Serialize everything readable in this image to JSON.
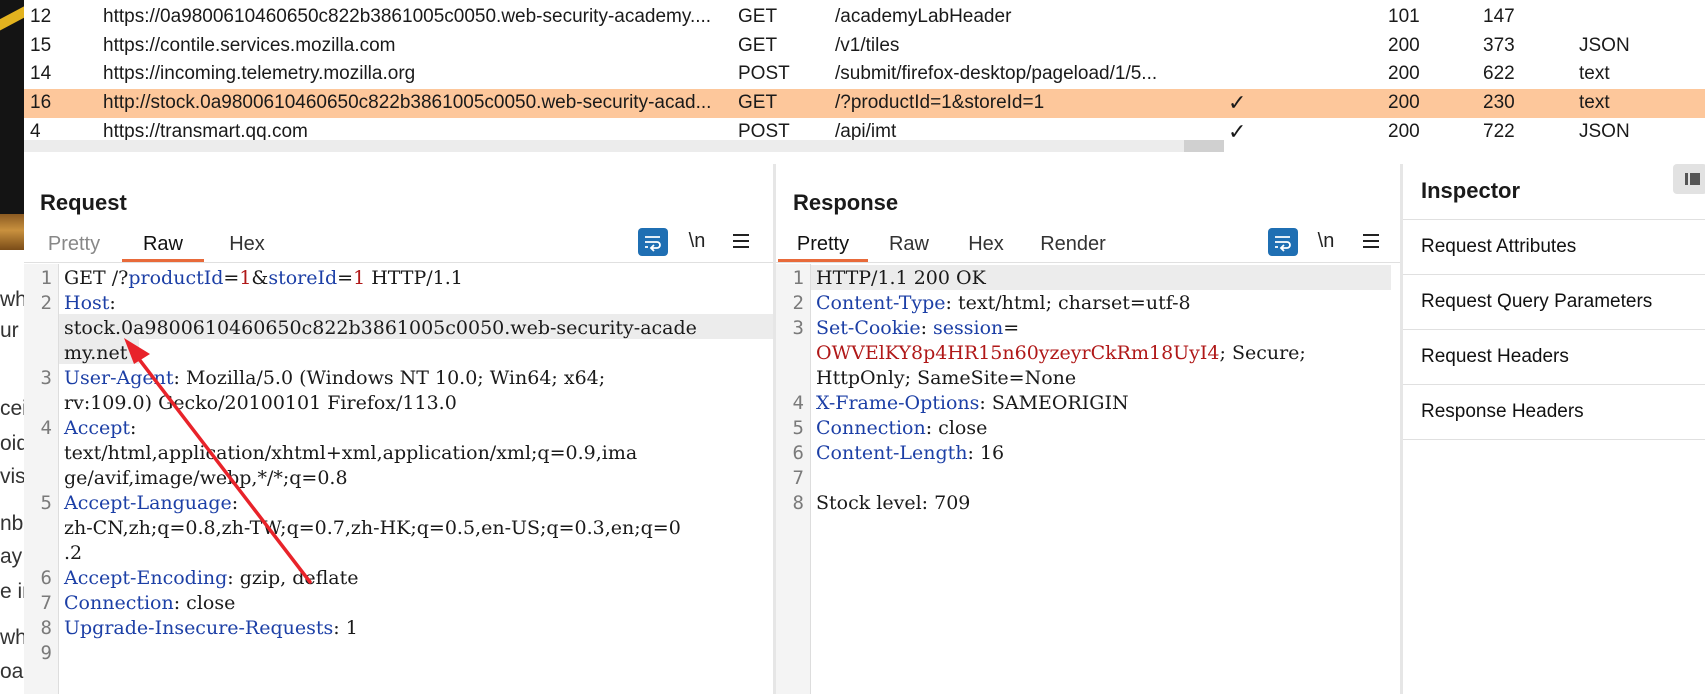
{
  "left_strip": {
    "fragments": [
      "wh",
      "ur",
      "cei",
      "oid",
      "vish",
      "nbo",
      "ay",
      "e in",
      "whe",
      "oac"
    ]
  },
  "history": {
    "rows": [
      {
        "id": "12",
        "host": "https://0a9800610460650c822b3861005c0050.web-security-academy....",
        "method": "GET",
        "url": "/academyLabHeader",
        "checked": "",
        "status": "101",
        "length": "147",
        "mime": ""
      },
      {
        "id": "15",
        "host": "https://contile.services.mozilla.com",
        "method": "GET",
        "url": "/v1/tiles",
        "checked": "",
        "status": "200",
        "length": "373",
        "mime": "JSON"
      },
      {
        "id": "14",
        "host": "https://incoming.telemetry.mozilla.org",
        "method": "POST",
        "url": "/submit/firefox-desktop/pageload/1/5...",
        "checked": "",
        "status": "200",
        "length": "622",
        "mime": "text"
      },
      {
        "id": "16",
        "host": "http://stock.0a9800610460650c822b3861005c0050.web-security-acad...",
        "method": "GET",
        "url": "/?productId=1&storeId=1",
        "checked": "✓",
        "status": "200",
        "length": "230",
        "mime": "text"
      },
      {
        "id": "4",
        "host": "https://transmart.qq.com",
        "method": "POST",
        "url": "/api/imt",
        "checked": "✓",
        "status": "200",
        "length": "722",
        "mime": "JSON"
      }
    ],
    "selected_index": 3
  },
  "request": {
    "title": "Request",
    "tabs": [
      "Pretty",
      "Raw",
      "Hex"
    ],
    "active_tab": "Raw",
    "newline_label": "\\n",
    "line_numbers": [
      "1",
      "2",
      "",
      "3",
      "",
      "4",
      "",
      "5",
      "",
      "6",
      "7",
      "8",
      "9"
    ],
    "lines": {
      "l1": {
        "a": "GET /?",
        "b": "productId",
        "c": "=",
        "d": "1",
        "e": "&",
        "f": "storeId",
        "g": "=",
        "h": "1",
        "i": " HTTP/1.1"
      },
      "l2": {
        "key": "Host",
        "sep": ":"
      },
      "l2b": "stock.0a9800610460650c822b3861005c0050.web-security-acade",
      "l2c": "my.net",
      "l3": {
        "key": "User-Agent",
        "val": ": Mozilla/5.0 (Windows NT 10.0; Win64; x64;"
      },
      "l3b": "rv:109.0) Gecko/20100101 Firefox/113.0",
      "l4": {
        "key": "Accept",
        "val": ":"
      },
      "l4b": "text/html,application/xhtml+xml,application/xml;q=0.9,ima",
      "l4c": "ge/avif,image/webp,*/*;q=0.8",
      "l5": {
        "key": "Accept-Language",
        "val": ":"
      },
      "l5b": "zh-CN,zh;q=0.8,zh-TW;q=0.7,zh-HK;q=0.5,en-US;q=0.3,en;q=0",
      "l5c": ".2",
      "l6": {
        "key": "Accept-Encoding",
        "val": ": gzip, deflate"
      },
      "l7": {
        "key": "Connection",
        "val": ": close"
      },
      "l8": {
        "key": "Upgrade-Insecure-Requests",
        "val": ": 1"
      }
    }
  },
  "response": {
    "title": "Response",
    "tabs": [
      "Pretty",
      "Raw",
      "Hex",
      "Render"
    ],
    "active_tab": "Pretty",
    "newline_label": "\\n",
    "line_numbers": [
      "1",
      "2",
      "3",
      "",
      "",
      "4",
      "5",
      "6",
      "7",
      "8"
    ],
    "lines": {
      "l1": "HTTP/1.1 200 OK",
      "l2": {
        "key": "Content-Type",
        "val": ": text/html; charset=utf-8"
      },
      "l3": {
        "key": "Set-Cookie",
        "val": ": ",
        "key2": "session",
        "val2": "="
      },
      "l3b": {
        "cookie": "OWVElKY8p4HR15n60yzeyrCkRm18UyI4",
        "rest": "; Secure;"
      },
      "l3c": "HttpOnly; SameSite=None",
      "l4": {
        "key": "X-Frame-Options",
        "val": ": SAMEORIGIN"
      },
      "l5": {
        "key": "Connection",
        "val": ": close"
      },
      "l6": {
        "key": "Content-Length",
        "val": ": 16"
      },
      "l8": "Stock level: 709"
    }
  },
  "inspector": {
    "title": "Inspector",
    "items": [
      "Request Attributes",
      "Request Query Parameters",
      "Request Headers",
      "Response Headers"
    ]
  },
  "colors": {
    "selected_row": "#fdc79b",
    "accent_blue": "#1f6fb3",
    "tab_underline": "#e86a3a",
    "header_key": "#1c3fa6",
    "value_red": "#b01818",
    "annotation_arrow": "#e8232a"
  }
}
